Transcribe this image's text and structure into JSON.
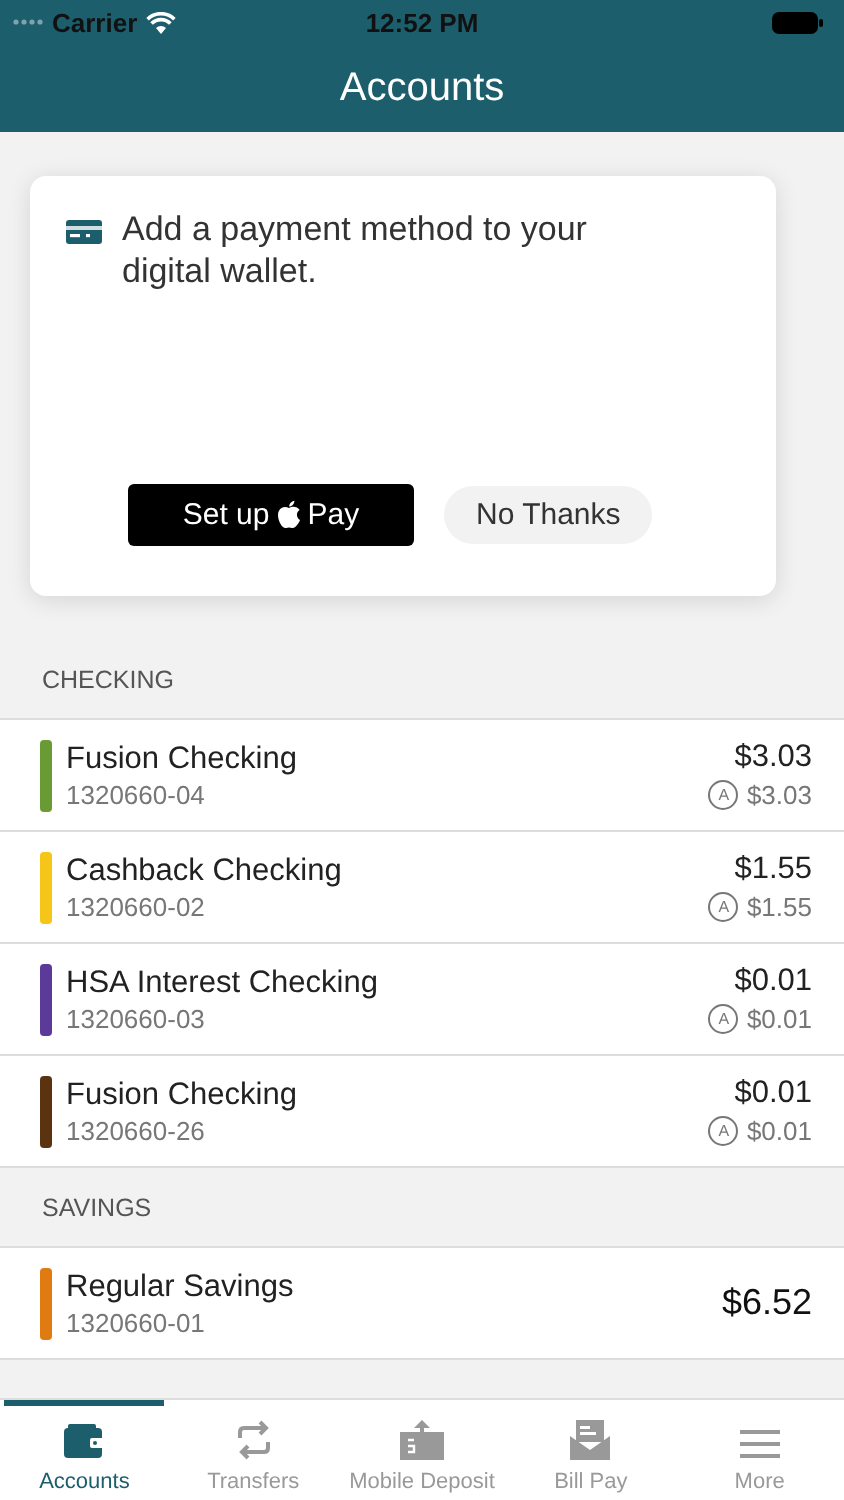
{
  "status_bar": {
    "carrier": "Carrier",
    "time": "12:52 PM"
  },
  "nav_bar": {
    "title": "Accounts"
  },
  "wallet_card": {
    "message": "Add a payment method to your digital wallet.",
    "setup_button": {
      "before": "Set up",
      "after": "Pay"
    },
    "dismiss_button": "No Thanks"
  },
  "sections": [
    {
      "title": "CHECKING",
      "accounts": [
        {
          "name": "Fusion Checking",
          "number": "1320660-04",
          "balance": "$3.03",
          "available_mark": "A",
          "available": "$3.03",
          "color": "#6a9a34"
        },
        {
          "name": "Cashback Checking",
          "number": "1320660-02",
          "balance": "$1.55",
          "available_mark": "A",
          "available": "$1.55",
          "color": "#f5c518"
        },
        {
          "name": "HSA Interest Checking",
          "number": "1320660-03",
          "balance": "$0.01",
          "available_mark": "A",
          "available": "$0.01",
          "color": "#5b3a9a"
        },
        {
          "name": "Fusion Checking",
          "number": "1320660-26",
          "balance": "$0.01",
          "available_mark": "A",
          "available": "$0.01",
          "color": "#5c3310"
        }
      ]
    },
    {
      "title": "SAVINGS",
      "accounts": [
        {
          "name": "Regular Savings",
          "number": "1320660-01",
          "balance": "$6.52",
          "color": "#e07b12"
        }
      ]
    }
  ],
  "tab_bar": [
    {
      "label": "Accounts",
      "kind": "wallet",
      "selected": true
    },
    {
      "label": "Transfers",
      "kind": "transfer",
      "selected": false
    },
    {
      "label": "Mobile Deposit",
      "kind": "deposit",
      "selected": false
    },
    {
      "label": "Bill Pay",
      "kind": "bill",
      "selected": false
    },
    {
      "label": "More",
      "kind": "menu",
      "selected": false
    }
  ]
}
